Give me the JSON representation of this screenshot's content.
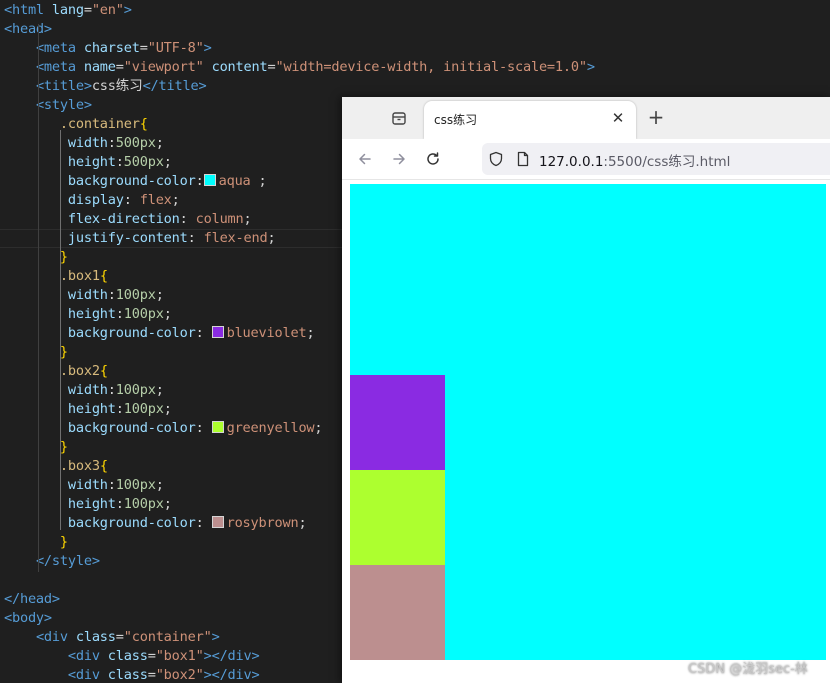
{
  "editor": {
    "lines": [
      [
        {
          "t": "<html",
          "c": "tag"
        },
        {
          "t": " lang",
          "c": "attr"
        },
        {
          "t": "=",
          "c": "punc"
        },
        {
          "t": "\"en\"",
          "c": "str"
        },
        {
          "t": ">",
          "c": "tag"
        }
      ],
      [
        {
          "t": "<head>",
          "c": "tag"
        }
      ],
      [
        {
          "t": "    "
        },
        {
          "t": "<meta",
          "c": "tag"
        },
        {
          "t": " charset",
          "c": "attr"
        },
        {
          "t": "=",
          "c": "punc"
        },
        {
          "t": "\"UTF-8\"",
          "c": "str"
        },
        {
          "t": ">",
          "c": "tag"
        }
      ],
      [
        {
          "t": "    "
        },
        {
          "t": "<meta",
          "c": "tag"
        },
        {
          "t": " name",
          "c": "attr"
        },
        {
          "t": "=",
          "c": "punc"
        },
        {
          "t": "\"viewport\"",
          "c": "str"
        },
        {
          "t": " content",
          "c": "attr"
        },
        {
          "t": "=",
          "c": "punc"
        },
        {
          "t": "\"width=device-width, initial-scale=1.0\"",
          "c": "str"
        },
        {
          "t": ">",
          "c": "tag"
        }
      ],
      [
        {
          "t": "    "
        },
        {
          "t": "<title>",
          "c": "tag"
        },
        {
          "t": "css练习",
          "c": "text"
        },
        {
          "t": "</title>",
          "c": "tag"
        }
      ],
      [
        {
          "t": "    "
        },
        {
          "t": "<style>",
          "c": "tag"
        }
      ],
      [
        {
          "t": "       "
        },
        {
          "t": ".container",
          "c": "sel"
        },
        {
          "t": "{",
          "c": "brace"
        }
      ],
      [
        {
          "t": "        "
        },
        {
          "t": "width",
          "c": "prop"
        },
        {
          "t": ":",
          "c": "punc"
        },
        {
          "t": "500px",
          "c": "num"
        },
        {
          "t": ";",
          "c": "punc"
        }
      ],
      [
        {
          "t": "        "
        },
        {
          "t": "height",
          "c": "prop"
        },
        {
          "t": ":",
          "c": "punc"
        },
        {
          "t": "500px",
          "c": "num"
        },
        {
          "t": ";",
          "c": "punc"
        }
      ],
      [
        {
          "t": "        "
        },
        {
          "t": "background-color",
          "c": "prop"
        },
        {
          "t": ":",
          "c": "punc"
        },
        {
          "sw": "#00ffff"
        },
        {
          "t": "aqua",
          "c": "val"
        },
        {
          "t": " ;",
          "c": "punc"
        }
      ],
      [
        {
          "t": "        "
        },
        {
          "t": "display",
          "c": "prop"
        },
        {
          "t": ": ",
          "c": "punc"
        },
        {
          "t": "flex",
          "c": "val"
        },
        {
          "t": ";",
          "c": "punc"
        }
      ],
      [
        {
          "t": "        "
        },
        {
          "t": "flex-direction",
          "c": "prop"
        },
        {
          "t": ": ",
          "c": "punc"
        },
        {
          "t": "column",
          "c": "val"
        },
        {
          "t": ";",
          "c": "punc"
        }
      ],
      [
        {
          "t": "        "
        },
        {
          "t": "justify-content",
          "c": "prop"
        },
        {
          "t": ": ",
          "c": "punc"
        },
        {
          "t": "flex-end",
          "c": "val"
        },
        {
          "t": ";",
          "c": "punc"
        }
      ],
      [
        {
          "t": "       "
        },
        {
          "t": "}",
          "c": "brace"
        }
      ],
      [
        {
          "t": "       "
        },
        {
          "t": ".box1",
          "c": "sel"
        },
        {
          "t": "{",
          "c": "brace"
        }
      ],
      [
        {
          "t": "        "
        },
        {
          "t": "width",
          "c": "prop"
        },
        {
          "t": ":",
          "c": "punc"
        },
        {
          "t": "100px",
          "c": "num"
        },
        {
          "t": ";",
          "c": "punc"
        }
      ],
      [
        {
          "t": "        "
        },
        {
          "t": "height",
          "c": "prop"
        },
        {
          "t": ":",
          "c": "punc"
        },
        {
          "t": "100px",
          "c": "num"
        },
        {
          "t": ";",
          "c": "punc"
        }
      ],
      [
        {
          "t": "        "
        },
        {
          "t": "background-color",
          "c": "prop"
        },
        {
          "t": ": ",
          "c": "punc"
        },
        {
          "sw": "#8a2be2"
        },
        {
          "t": "blueviolet",
          "c": "val"
        },
        {
          "t": ";",
          "c": "punc"
        }
      ],
      [
        {
          "t": "       "
        },
        {
          "t": "}",
          "c": "brace"
        }
      ],
      [
        {
          "t": "       "
        },
        {
          "t": ".box2",
          "c": "sel"
        },
        {
          "t": "{",
          "c": "brace"
        }
      ],
      [
        {
          "t": "        "
        },
        {
          "t": "width",
          "c": "prop"
        },
        {
          "t": ":",
          "c": "punc"
        },
        {
          "t": "100px",
          "c": "num"
        },
        {
          "t": ";",
          "c": "punc"
        }
      ],
      [
        {
          "t": "        "
        },
        {
          "t": "height",
          "c": "prop"
        },
        {
          "t": ":",
          "c": "punc"
        },
        {
          "t": "100px",
          "c": "num"
        },
        {
          "t": ";",
          "c": "punc"
        }
      ],
      [
        {
          "t": "        "
        },
        {
          "t": "background-color",
          "c": "prop"
        },
        {
          "t": ": ",
          "c": "punc"
        },
        {
          "sw": "#adff2f"
        },
        {
          "t": "greenyellow",
          "c": "val"
        },
        {
          "t": ";",
          "c": "punc"
        }
      ],
      [
        {
          "t": "       "
        },
        {
          "t": "}",
          "c": "brace"
        }
      ],
      [
        {
          "t": "       "
        },
        {
          "t": ".box3",
          "c": "sel"
        },
        {
          "t": "{",
          "c": "brace"
        }
      ],
      [
        {
          "t": "        "
        },
        {
          "t": "width",
          "c": "prop"
        },
        {
          "t": ":",
          "c": "punc"
        },
        {
          "t": "100px",
          "c": "num"
        },
        {
          "t": ";",
          "c": "punc"
        }
      ],
      [
        {
          "t": "        "
        },
        {
          "t": "height",
          "c": "prop"
        },
        {
          "t": ":",
          "c": "punc"
        },
        {
          "t": "100px",
          "c": "num"
        },
        {
          "t": ";",
          "c": "punc"
        }
      ],
      [
        {
          "t": "        "
        },
        {
          "t": "background-color",
          "c": "prop"
        },
        {
          "t": ": ",
          "c": "punc"
        },
        {
          "sw": "#bc8f8f"
        },
        {
          "t": "rosybrown",
          "c": "val"
        },
        {
          "t": ";",
          "c": "punc"
        }
      ],
      [
        {
          "t": "       "
        },
        {
          "t": "}",
          "c": "brace"
        }
      ],
      [
        {
          "t": "    "
        },
        {
          "t": "</style>",
          "c": "tag"
        }
      ],
      [],
      [
        {
          "t": "</head>",
          "c": "tag"
        }
      ],
      [
        {
          "t": "<body>",
          "c": "tag"
        }
      ],
      [
        {
          "t": "    "
        },
        {
          "t": "<div",
          "c": "tag"
        },
        {
          "t": " class",
          "c": "attr"
        },
        {
          "t": "=",
          "c": "punc"
        },
        {
          "t": "\"container\"",
          "c": "str"
        },
        {
          "t": ">",
          "c": "tag"
        }
      ],
      [
        {
          "t": "        "
        },
        {
          "t": "<div",
          "c": "tag"
        },
        {
          "t": " class",
          "c": "attr"
        },
        {
          "t": "=",
          "c": "punc"
        },
        {
          "t": "\"box1\"",
          "c": "str"
        },
        {
          "t": "></div>",
          "c": "tag"
        }
      ],
      [
        {
          "t": "        "
        },
        {
          "t": "<div",
          "c": "tag"
        },
        {
          "t": " class",
          "c": "attr"
        },
        {
          "t": "=",
          "c": "punc"
        },
        {
          "t": "\"box2\"",
          "c": "str"
        },
        {
          "t": "></div>",
          "c": "tag"
        }
      ]
    ]
  },
  "browser": {
    "tab_title": "css练习",
    "tab_close": "✕",
    "new_tab": "+",
    "url_host": "127.0.0.1",
    "url_rest": ":5500/css练习.html"
  },
  "page": {
    "container_color": "#00ffff",
    "boxes": [
      {
        "name": "box1",
        "color": "#8a2be2"
      },
      {
        "name": "box2",
        "color": "#adff2f"
      },
      {
        "name": "box3",
        "color": "#bc8f8f"
      }
    ]
  },
  "watermark": "CSDN @泷羽sec-林"
}
